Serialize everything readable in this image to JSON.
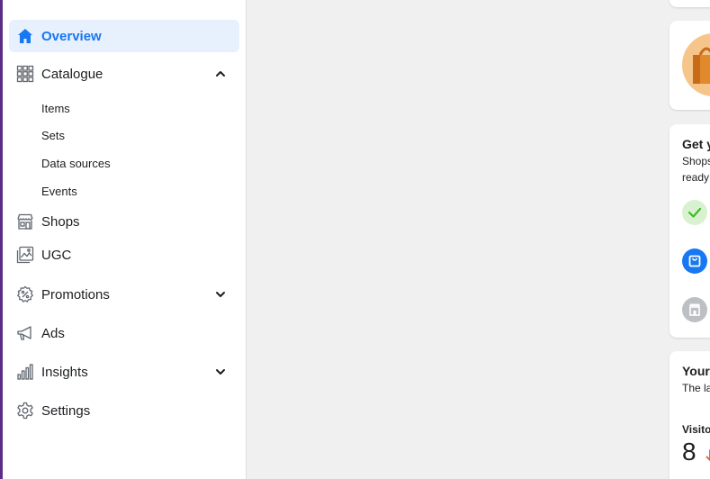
{
  "nav": {
    "overview": "Overview",
    "catalogue": "Catalogue",
    "catalogue_items": [
      "Items",
      "Sets",
      "Data sources",
      "Events"
    ],
    "shops": "Shops",
    "ugc": "UGC",
    "promotions": "Promotions",
    "ads": "Ads",
    "insights": "Insights",
    "settings": "Settings"
  },
  "right_cards": {
    "setup": {
      "title": "Get y",
      "line1": "Shops",
      "line2": "ready"
    },
    "stats": {
      "title": "Your",
      "subtitle": "The la",
      "visitors_label": "Visito",
      "visitors_value": "8"
    }
  },
  "colors": {
    "accent": "#1877f2",
    "active_bg": "#e7f0fd",
    "success": "#42b72a",
    "success_bg": "#d8f2cf",
    "disabled": "#bcc0c4",
    "edge": "#5b2d86"
  }
}
